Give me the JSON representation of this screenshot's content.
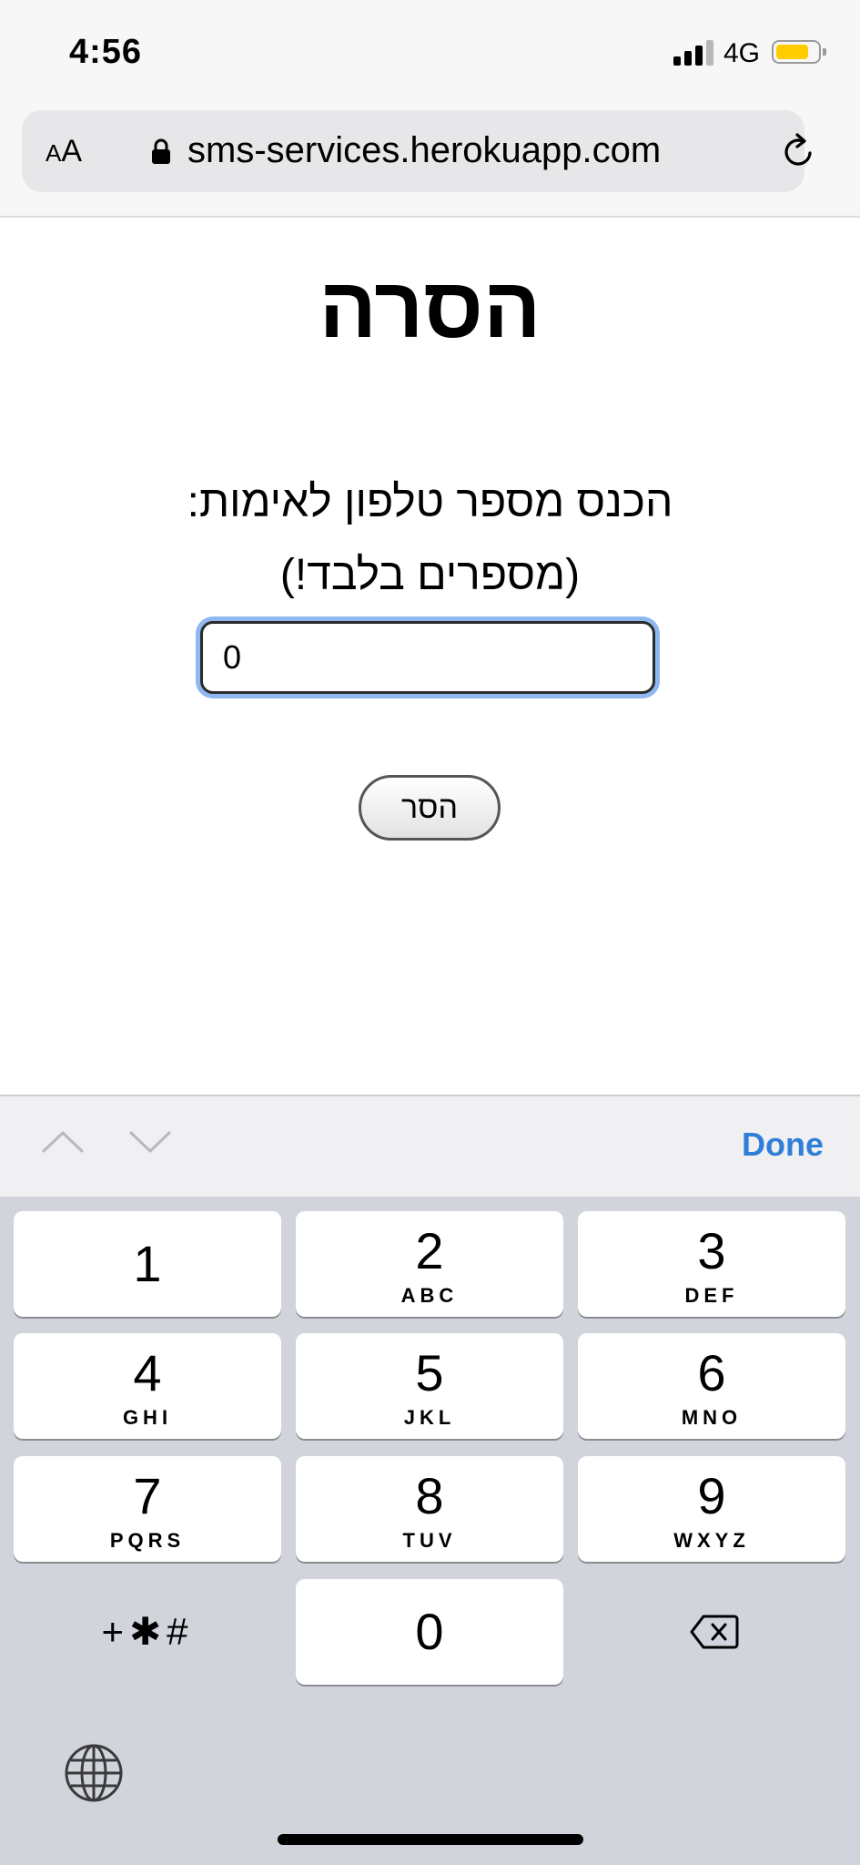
{
  "status_bar": {
    "time": "4:56",
    "network": "4G",
    "battery_level": 0.75,
    "battery_color": "#ffcc00"
  },
  "browser": {
    "text_size_button": {
      "small": "A",
      "large": "A"
    },
    "url": "sms-services.herokuapp.com",
    "lock_icon": "lock-icon",
    "reload_icon": "reload-icon"
  },
  "page": {
    "title": "הסרה",
    "prompt_line1": "הכנס מספר טלפון לאימות:",
    "prompt_line2": "(מספרים בלבד!)",
    "phone_input": {
      "value": "0"
    },
    "remove_button": "הסר"
  },
  "accessory_bar": {
    "prev_icon": "chevron-up-icon",
    "next_icon": "chevron-down-icon",
    "done_label": "Done",
    "done_color": "#2f7fd8"
  },
  "keypad": {
    "keys": [
      {
        "digit": "1",
        "letters": ""
      },
      {
        "digit": "2",
        "letters": "ABC"
      },
      {
        "digit": "3",
        "letters": "DEF"
      },
      {
        "digit": "4",
        "letters": "GHI"
      },
      {
        "digit": "5",
        "letters": "JKL"
      },
      {
        "digit": "6",
        "letters": "MNO"
      },
      {
        "digit": "7",
        "letters": "PQRS"
      },
      {
        "digit": "8",
        "letters": "TUV"
      },
      {
        "digit": "9",
        "letters": "WXYZ"
      },
      {
        "digit": "0",
        "letters": ""
      }
    ],
    "symbols_label": "+✱#",
    "delete_icon": "backspace-icon",
    "globe_icon": "globe-icon"
  }
}
